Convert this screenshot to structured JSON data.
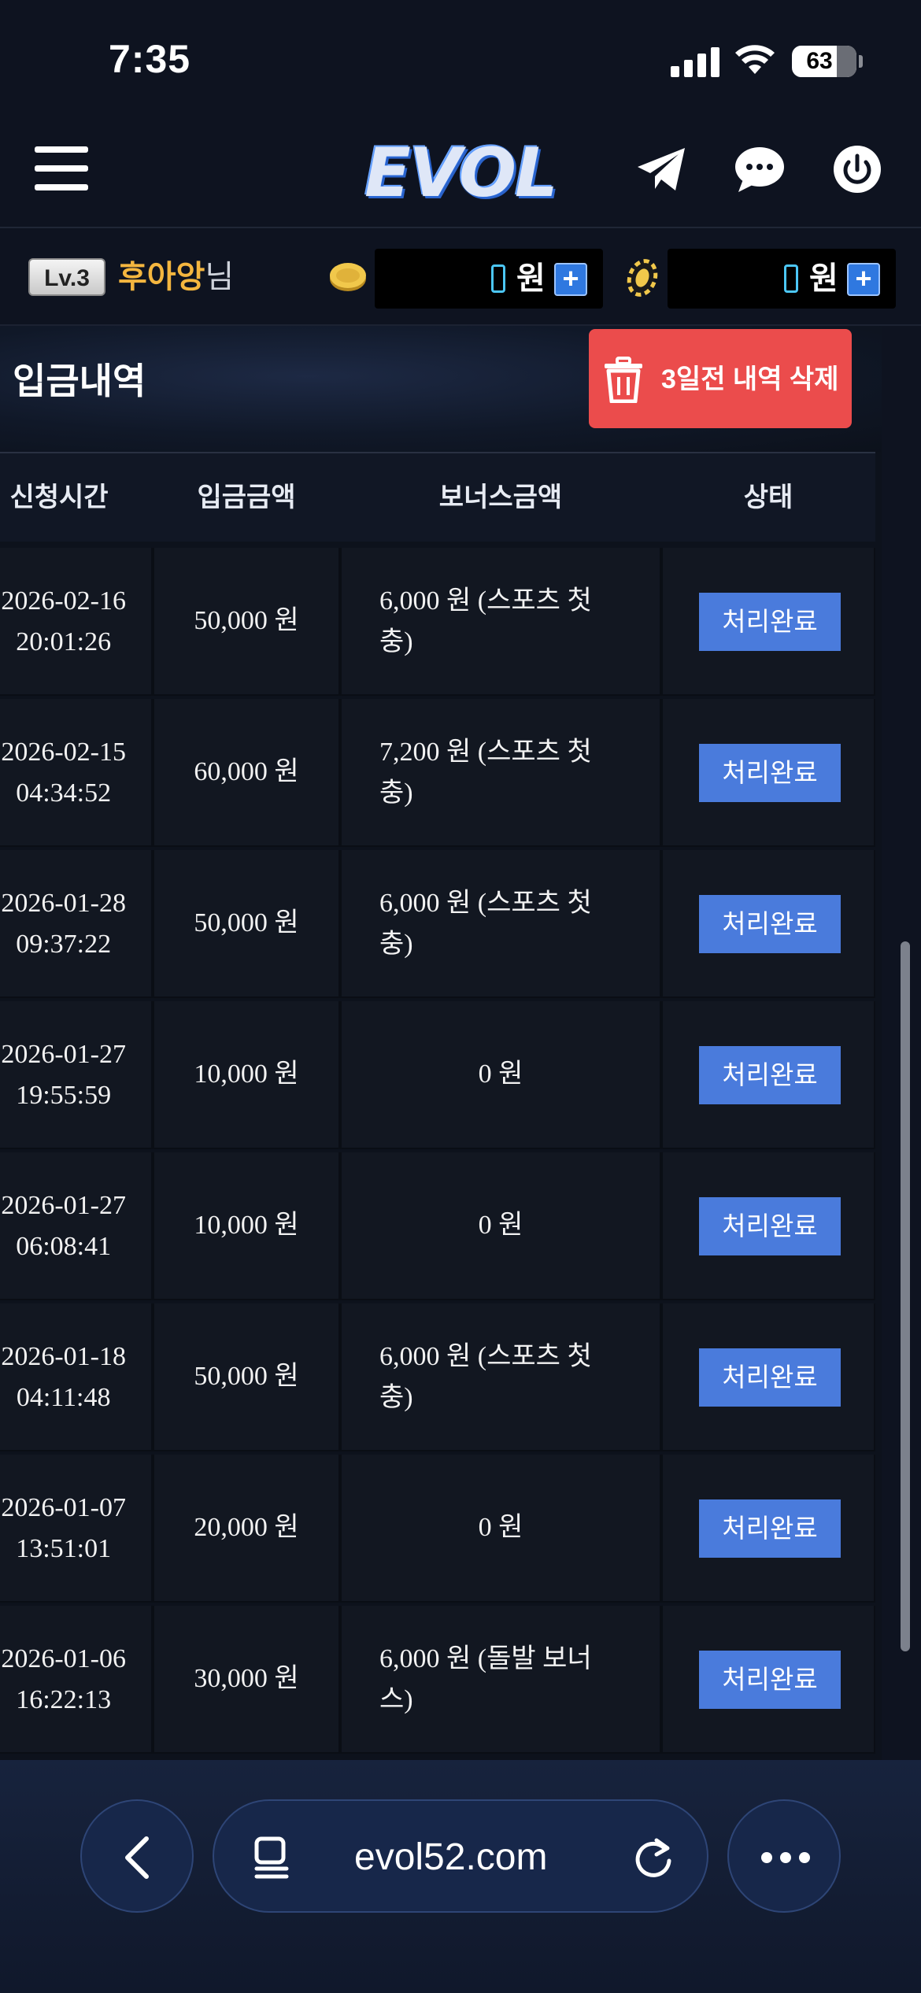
{
  "status_bar": {
    "time": "7:35",
    "battery": "63"
  },
  "header": {
    "logo": "EVOL",
    "icons": [
      "menu-icon",
      "telegram-icon",
      "chat-icon",
      "power-icon"
    ]
  },
  "user": {
    "level": "Lv.3",
    "name": "후아앙",
    "suffix": "님",
    "balances": [
      {
        "icon": "coin-icon",
        "unit": "원",
        "plus": "+"
      },
      {
        "icon": "chip-icon",
        "unit": "원",
        "plus": "+"
      }
    ]
  },
  "page": {
    "title": "입금내역",
    "delete_button": "3일전 내역 삭제",
    "columns": [
      "신청시간",
      "입금금액",
      "보너스금액",
      "상태"
    ],
    "rows": [
      {
        "date": "2026-02-16",
        "time": "20:01:26",
        "amount": "50,000 원",
        "bonus": "6,000 원 (스포츠 첫충)",
        "status": "처리완료"
      },
      {
        "date": "2026-02-15",
        "time": "04:34:52",
        "amount": "60,000 원",
        "bonus": "7,200 원 (스포츠 첫충)",
        "status": "처리완료"
      },
      {
        "date": "2026-01-28",
        "time": "09:37:22",
        "amount": "50,000 원",
        "bonus": "6,000 원 (스포츠 첫충)",
        "status": "처리완료"
      },
      {
        "date": "2026-01-27",
        "time": "19:55:59",
        "amount": "10,000 원",
        "bonus": "0 원",
        "status": "처리완료"
      },
      {
        "date": "2026-01-27",
        "time": "06:08:41",
        "amount": "10,000 원",
        "bonus": "0 원",
        "status": "처리완료"
      },
      {
        "date": "2026-01-18",
        "time": "04:11:48",
        "amount": "50,000 원",
        "bonus": "6,000 원 (스포츠 첫충)",
        "status": "처리완료"
      },
      {
        "date": "2026-01-07",
        "time": "13:51:01",
        "amount": "20,000 원",
        "bonus": "0 원",
        "status": "처리완료"
      },
      {
        "date": "2026-01-06",
        "time": "16:22:13",
        "amount": "30,000 원",
        "bonus": "6,000 원 (돌발 보너스)",
        "status": "처리완료"
      }
    ]
  },
  "browser": {
    "url": "evol52.com"
  },
  "colors": {
    "accent": "#4a7bdc",
    "danger": "#eb4c4c",
    "gold": "#f4b63f",
    "background": "#0e1320"
  }
}
